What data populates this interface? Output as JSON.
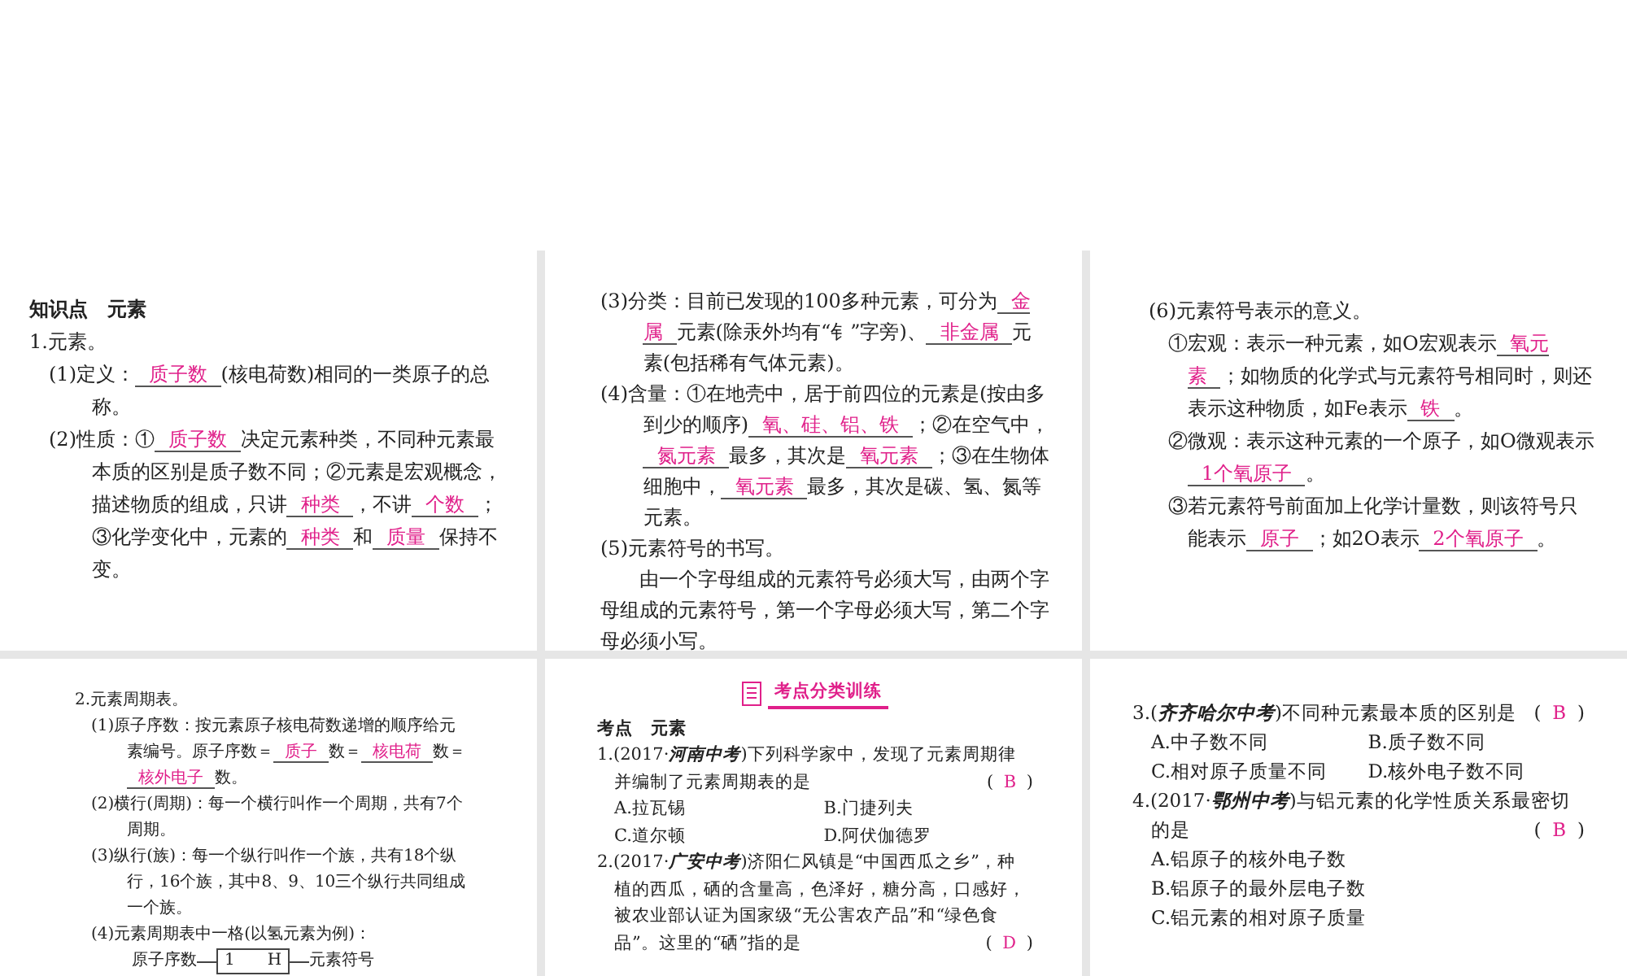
{
  "slides": [
    {
      "paragraphs": [
        {
          "kind": "heading",
          "parts": [
            {
              "kind": "text",
              "text": "知识点　元素"
            }
          ]
        },
        {
          "kind": "item",
          "parts": [
            {
              "kind": "text",
              "text": "1.元素。"
            }
          ]
        },
        {
          "kind": "sub",
          "parts": [
            {
              "kind": "text",
              "text": "(1)定义："
            },
            {
              "kind": "answer",
              "text": "质子数"
            },
            {
              "kind": "text",
              "text": "(核电荷数)相同的一类原子的总称。"
            }
          ]
        },
        {
          "kind": "sub",
          "parts": [
            {
              "kind": "text",
              "text": "(2)性质：①"
            },
            {
              "kind": "answer",
              "text": "质子数"
            },
            {
              "kind": "text",
              "text": "决定元素种类，不同种元素最本质的区别是质子数不同；②元素是宏观概念，描述物质的组成，只讲"
            },
            {
              "kind": "answer",
              "text": "种类"
            },
            {
              "kind": "text",
              "text": "，不讲"
            },
            {
              "kind": "answer",
              "text": "个数"
            },
            {
              "kind": "text",
              "text": "；③化学变化中，元素的"
            },
            {
              "kind": "answer",
              "text": "种类"
            },
            {
              "kind": "text",
              "text": "和"
            },
            {
              "kind": "answer",
              "text": "质量"
            },
            {
              "kind": "text",
              "text": "保持不变。"
            }
          ]
        }
      ]
    },
    {
      "paragraphs": [
        {
          "kind": "sub",
          "parts": [
            {
              "kind": "text",
              "text": "(3)分类：目前已发现的100多种元素，可分为"
            },
            {
              "kind": "answer",
              "text": "金属"
            },
            {
              "kind": "text",
              "text": "元素(除汞外均有“钅”字旁)、"
            },
            {
              "kind": "answer",
              "text": "非金属"
            },
            {
              "kind": "text",
              "text": "元素(包括稀有气体元素)。"
            }
          ]
        },
        {
          "kind": "sub",
          "parts": [
            {
              "kind": "text",
              "text": "(4)含量：①在地壳中，居于前四位的元素是(按由多到少的顺序)"
            },
            {
              "kind": "answer",
              "text": "氧、硅、铝、铁"
            },
            {
              "kind": "text",
              "text": "；②在空气中，"
            },
            {
              "kind": "answer",
              "text": "氮元素"
            },
            {
              "kind": "text",
              "text": "最多，其次是"
            },
            {
              "kind": "answer",
              "text": "氧元素"
            },
            {
              "kind": "text",
              "text": "；③在生物体细胞中，"
            },
            {
              "kind": "answer",
              "text": "氧元素"
            },
            {
              "kind": "text",
              "text": "最多，其次是碳、氢、氮等元素。"
            }
          ]
        },
        {
          "kind": "sub",
          "parts": [
            {
              "kind": "text",
              "text": "(5)元素符号的书写。"
            }
          ]
        },
        {
          "kind": "body",
          "parts": [
            {
              "kind": "text",
              "text": "由一个字母组成的元素符号必须大写，由两个字母组成的元素符号，第一个字母必须大写，第二个字母必须小写。"
            }
          ]
        }
      ]
    },
    {
      "paragraphs": [
        {
          "kind": "sub",
          "parts": [
            {
              "kind": "text",
              "text": "(6)元素符号表示的意义。"
            }
          ]
        },
        {
          "kind": "subsub",
          "parts": [
            {
              "kind": "text",
              "text": "①宏观：表示一种元素，如O宏观表示"
            },
            {
              "kind": "answer",
              "text": "氧元素"
            },
            {
              "kind": "text",
              "text": "；如物质的化学式与元素符号相同时，则还表示这种物质，如Fe表示"
            },
            {
              "kind": "answer",
              "text": "铁"
            },
            {
              "kind": "text",
              "text": "。"
            }
          ]
        },
        {
          "kind": "subsub",
          "parts": [
            {
              "kind": "text",
              "text": "②微观：表示这种元素的一个原子，如O微观表示"
            },
            {
              "kind": "answer",
              "text": "1个氧原子"
            },
            {
              "kind": "text",
              "text": "。"
            }
          ]
        },
        {
          "kind": "subsub",
          "parts": [
            {
              "kind": "text",
              "text": "③若元素符号前面加上化学计量数，则该符号只能表示"
            },
            {
              "kind": "answer",
              "text": "原子"
            },
            {
              "kind": "text",
              "text": "；如2O表示"
            },
            {
              "kind": "answer",
              "text": "2个氧原子"
            },
            {
              "kind": "text",
              "text": "。"
            }
          ]
        }
      ]
    },
    {
      "paragraphs": [
        {
          "kind": "item",
          "parts": [
            {
              "kind": "text",
              "text": "2.元素周期表。"
            }
          ]
        },
        {
          "kind": "sub",
          "parts": [
            {
              "kind": "text",
              "text": "(1)原子序数：按元素原子核电荷数递增的顺序给元素编号。原子序数＝"
            },
            {
              "kind": "answer",
              "text": "质子"
            },
            {
              "kind": "text",
              "text": "数＝"
            },
            {
              "kind": "answer",
              "text": "核电荷"
            },
            {
              "kind": "text",
              "text": "数＝"
            },
            {
              "kind": "answer",
              "text": "核外电子"
            },
            {
              "kind": "text",
              "text": "数。"
            }
          ]
        },
        {
          "kind": "sub",
          "parts": [
            {
              "kind": "text",
              "text": "(2)横行(周期)：每一个横行叫作一个周期，共有7个周期。"
            }
          ]
        },
        {
          "kind": "sub",
          "parts": [
            {
              "kind": "text",
              "text": "(3)纵行(族)：每一个纵行叫作一个族，共有18个纵行，16个族，其中8、9、10三个纵行共同组成一个族。"
            }
          ]
        },
        {
          "kind": "sub",
          "parts": [
            {
              "kind": "text",
              "text": "(4)元素周期表中一格(以氢元素为例)："
            }
          ]
        },
        {
          "kind": "cell",
          "left": "原子序数",
          "number": "1",
          "symbol": "H",
          "right": "元素符号"
        }
      ]
    },
    {
      "paragraphs": [
        {
          "kind": "banner",
          "parts": [
            {
              "kind": "text",
              "text": "考点分类训练"
            }
          ]
        },
        {
          "kind": "heading",
          "parts": [
            {
              "kind": "text",
              "text": "考点　元素"
            }
          ]
        },
        {
          "kind": "question",
          "parts": [
            {
              "kind": "text",
              "text": "1.(2017·"
            },
            {
              "kind": "source",
              "text": "河南中考"
            },
            {
              "kind": "text",
              "text": ")下列科学家中，发现了元素周期律并编制了元素周期表的是"
            }
          ],
          "choice": {
            "open": "(",
            "letter": "B",
            "close": ")"
          }
        },
        {
          "kind": "options",
          "options": [
            "A.拉瓦锡",
            "B.门捷列夫",
            "C.道尔顿",
            "D.阿伏伽德罗"
          ]
        },
        {
          "kind": "question",
          "parts": [
            {
              "kind": "text",
              "text": "2.(2017·"
            },
            {
              "kind": "source",
              "text": "广安中考"
            },
            {
              "kind": "text",
              "text": ")济阳仁风镇是“中国西瓜之乡”，种植的西瓜，硒的含量高，色泽好，糖分高，口感好，被农业部认证为国家级“无公害农产品”和“绿色食品”。这里的“硒”指的是"
            }
          ],
          "choice": {
            "open": "(",
            "letter": "D",
            "close": ")"
          }
        }
      ]
    },
    {
      "paragraphs": [
        {
          "kind": "question",
          "parts": [
            {
              "kind": "text",
              "text": "3.("
            },
            {
              "kind": "source",
              "text": "齐齐哈尔中考"
            },
            {
              "kind": "text",
              "text": ")不同种元素最本质的区别是"
            }
          ],
          "choice": {
            "open": "(",
            "letter": "B",
            "close": ")"
          }
        },
        {
          "kind": "options",
          "options": [
            "A.中子数不同",
            "B.质子数不同",
            "C.相对原子质量不同",
            "D.核外电子数不同"
          ]
        },
        {
          "kind": "question",
          "parts": [
            {
              "kind": "text",
              "text": "4.(2017·"
            },
            {
              "kind": "source",
              "text": "鄂州中考"
            },
            {
              "kind": "text",
              "text": ")与铝元素的化学性质关系最密切的是"
            }
          ],
          "choice": {
            "open": "(",
            "letter": "B",
            "close": ")"
          }
        },
        {
          "kind": "list",
          "options": [
            "A.铝原子的核外电子数",
            "B.铝原子的最外层电子数",
            "C.铝元素的相对原子质量"
          ]
        }
      ]
    }
  ]
}
